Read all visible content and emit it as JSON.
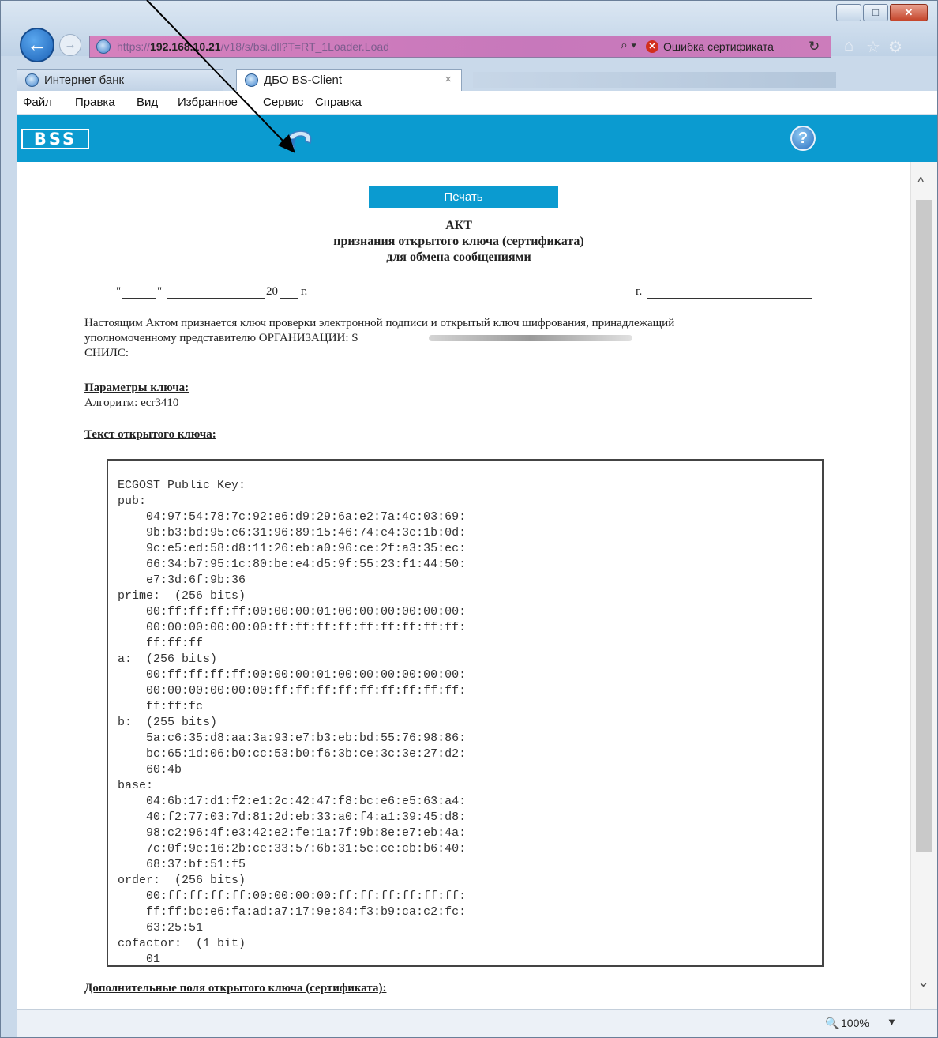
{
  "window": {
    "controls": {
      "minimize": "–",
      "maximize": "□",
      "close": "✕"
    }
  },
  "browser": {
    "nav": {
      "back_icon": "←",
      "forward_icon": "→"
    },
    "address": {
      "url_prefix": "https://",
      "host": "192.168.10.21",
      "url_path": "/v18/s/bsi.dll?T=RT_1Loader.Load",
      "search_icon": "⌕ ▾",
      "cert_error_icon": "✕",
      "cert_error": "Ошибка сертификата",
      "refresh_icon": "↻"
    },
    "toolbar_icons": {
      "home": "⌂",
      "favorites": "☆",
      "tools": "⚙"
    },
    "tabs": [
      {
        "label": "Интернет банк"
      },
      {
        "label": "ДБО BS-Client",
        "close": "×"
      }
    ],
    "menu": [
      "Файл",
      "Правка",
      "Вид",
      "Избранное",
      "Сервис",
      "Справка"
    ]
  },
  "app": {
    "logo": "BSS",
    "help": "?"
  },
  "document": {
    "print_label": "Печать",
    "title": "АКТ",
    "subtitle1": "признания открытого ключа (сертификата)",
    "subtitle2": "для обмена сообщениями",
    "date_line": {
      "quote_open": "\"",
      "quote_close": "\"",
      "year_prefix": "20",
      "year_suffix": "г.",
      "city_prefix": "г."
    },
    "intro_line1": "Настоящим Актом признается ключ проверки электронной подписи и открытый ключ шифрования, принадлежащий",
    "intro_line2": "уполномоченному представителю ОРГАНИЗАЦИИ: S",
    "snils_label": "СНИЛС:",
    "params_heading": "Параметры ключа:",
    "algorithm": "Алгоритм: ecr3410",
    "pubkey_heading": "Текст открытого ключа:",
    "key_text": "ECGOST Public Key:\npub:\n    04:97:54:78:7c:92:e6:d9:29:6a:e2:7a:4c:03:69:\n    9b:b3:bd:95:e6:31:96:89:15:46:74:e4:3e:1b:0d:\n    9c:e5:ed:58:d8:11:26:eb:a0:96:ce:2f:a3:35:ec:\n    66:34:b7:95:1c:80:be:e4:d5:9f:55:23:f1:44:50:\n    e7:3d:6f:9b:36\nprime:  (256 bits)\n    00:ff:ff:ff:ff:00:00:00:01:00:00:00:00:00:00:\n    00:00:00:00:00:00:ff:ff:ff:ff:ff:ff:ff:ff:ff:\n    ff:ff:ff\na:  (256 bits)\n    00:ff:ff:ff:ff:00:00:00:01:00:00:00:00:00:00:\n    00:00:00:00:00:00:ff:ff:ff:ff:ff:ff:ff:ff:ff:\n    ff:ff:fc\nb:  (255 bits)\n    5a:c6:35:d8:aa:3a:93:e7:b3:eb:bd:55:76:98:86:\n    bc:65:1d:06:b0:cc:53:b0:f6:3b:ce:3c:3e:27:d2:\n    60:4b\nbase:\n    04:6b:17:d1:f2:e1:2c:42:47:f8:bc:e6:e5:63:a4:\n    40:f2:77:03:7d:81:2d:eb:33:a0:f4:a1:39:45:d8:\n    98:c2:96:4f:e3:42:e2:fe:1a:7f:9b:8e:e7:eb:4a:\n    7c:0f:9e:16:2b:ce:33:57:6b:31:5e:ce:cb:b6:40:\n    68:37:bf:51:f5\norder:  (256 bits)\n    00:ff:ff:ff:ff:00:00:00:00:ff:ff:ff:ff:ff:ff:\n    ff:ff:bc:e6:fa:ad:a7:17:9e:84:f3:b9:ca:c2:fc:\n    63:25:51\ncofactor:  (1 bit)\n    01",
    "extra_heading": "Дополнительные поля открытого ключа (сертификата):"
  },
  "scrollbar": {
    "up": "^",
    "down": "⌄"
  },
  "status": {
    "zoom_icon": "🔍",
    "zoom": "100%",
    "zoom_dropdown": "▼"
  }
}
